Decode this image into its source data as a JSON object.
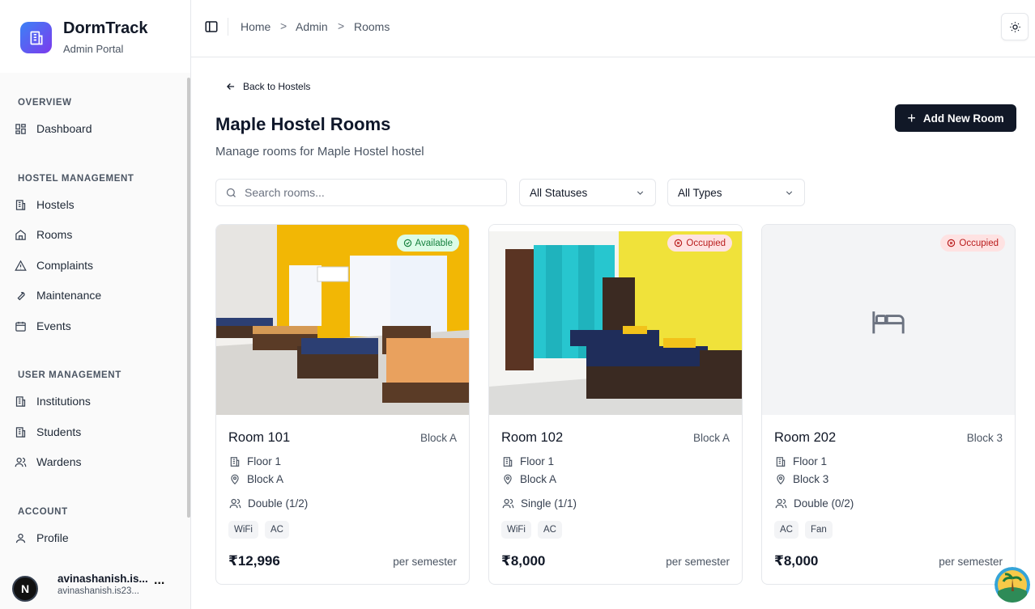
{
  "brand": {
    "title": "DormTrack",
    "subtitle": "Admin Portal"
  },
  "sidebar": {
    "sections": [
      {
        "label": "OVERVIEW",
        "items": [
          {
            "label": "Dashboard",
            "icon": "dashboard-icon"
          }
        ]
      },
      {
        "label": "HOSTEL MANAGEMENT",
        "items": [
          {
            "label": "Hostels",
            "icon": "building-icon"
          },
          {
            "label": "Rooms",
            "icon": "home-icon"
          },
          {
            "label": "Complaints",
            "icon": "warning-icon"
          },
          {
            "label": "Maintenance",
            "icon": "wrench-icon"
          },
          {
            "label": "Events",
            "icon": "calendar-icon"
          }
        ]
      },
      {
        "label": "USER MANAGEMENT",
        "items": [
          {
            "label": "Institutions",
            "icon": "building-icon"
          },
          {
            "label": "Students",
            "icon": "building-icon"
          },
          {
            "label": "Wardens",
            "icon": "users-icon"
          }
        ]
      },
      {
        "label": "ACCOUNT",
        "items": [
          {
            "label": "Profile",
            "icon": "user-icon"
          }
        ]
      }
    ],
    "user": {
      "initial": "N",
      "name": "avinashanish.is...",
      "email": "avinashanish.is23...",
      "more": "..."
    }
  },
  "header": {
    "breadcrumb": [
      "Home",
      "Admin",
      "Rooms"
    ],
    "separator": ">"
  },
  "main": {
    "back_label": "Back to Hostels",
    "title": "Maple Hostel Rooms",
    "subtitle": "Manage rooms for Maple Hostel hostel",
    "add_button": "Add New Room",
    "add_button_icon": "+",
    "search": {
      "placeholder": "Search rooms...",
      "value": ""
    },
    "status_filter": "All Statuses",
    "type_filter": "All Types"
  },
  "rooms": [
    {
      "name": "Room 101",
      "block": "Block A",
      "status": "Available",
      "floor": "Floor 1",
      "location": "Block A",
      "occupancy": "Double (1/2)",
      "amenities": [
        "WiFi",
        "AC"
      ],
      "price": "₹12,996",
      "period": "per semester",
      "image": "room-photo-yellow-dorm"
    },
    {
      "name": "Room 102",
      "block": "Block A",
      "status": "Occupied",
      "floor": "Floor 1",
      "location": "Block A",
      "occupancy": "Single (1/1)",
      "amenities": [
        "WiFi",
        "AC"
      ],
      "price": "₹8,000",
      "period": "per semester",
      "image": "room-photo-teal-curtain"
    },
    {
      "name": "Room 202",
      "block": "Block 3",
      "status": "Occupied",
      "floor": "Floor 1",
      "location": "Block 3",
      "occupancy": "Double (0/2)",
      "amenities": [
        "AC",
        "Fan"
      ],
      "price": "₹8,000",
      "period": "per semester",
      "image": "bed-placeholder-icon"
    }
  ],
  "colors": {
    "brand_gradient_start": "#3b82f6",
    "brand_gradient_end": "#7c3aed",
    "primary_button": "#111827",
    "available_badge_bg": "#dcfce7",
    "available_badge_text": "#15803d",
    "occupied_badge_bg": "#fee2e2",
    "occupied_badge_text": "#b91c1c"
  }
}
